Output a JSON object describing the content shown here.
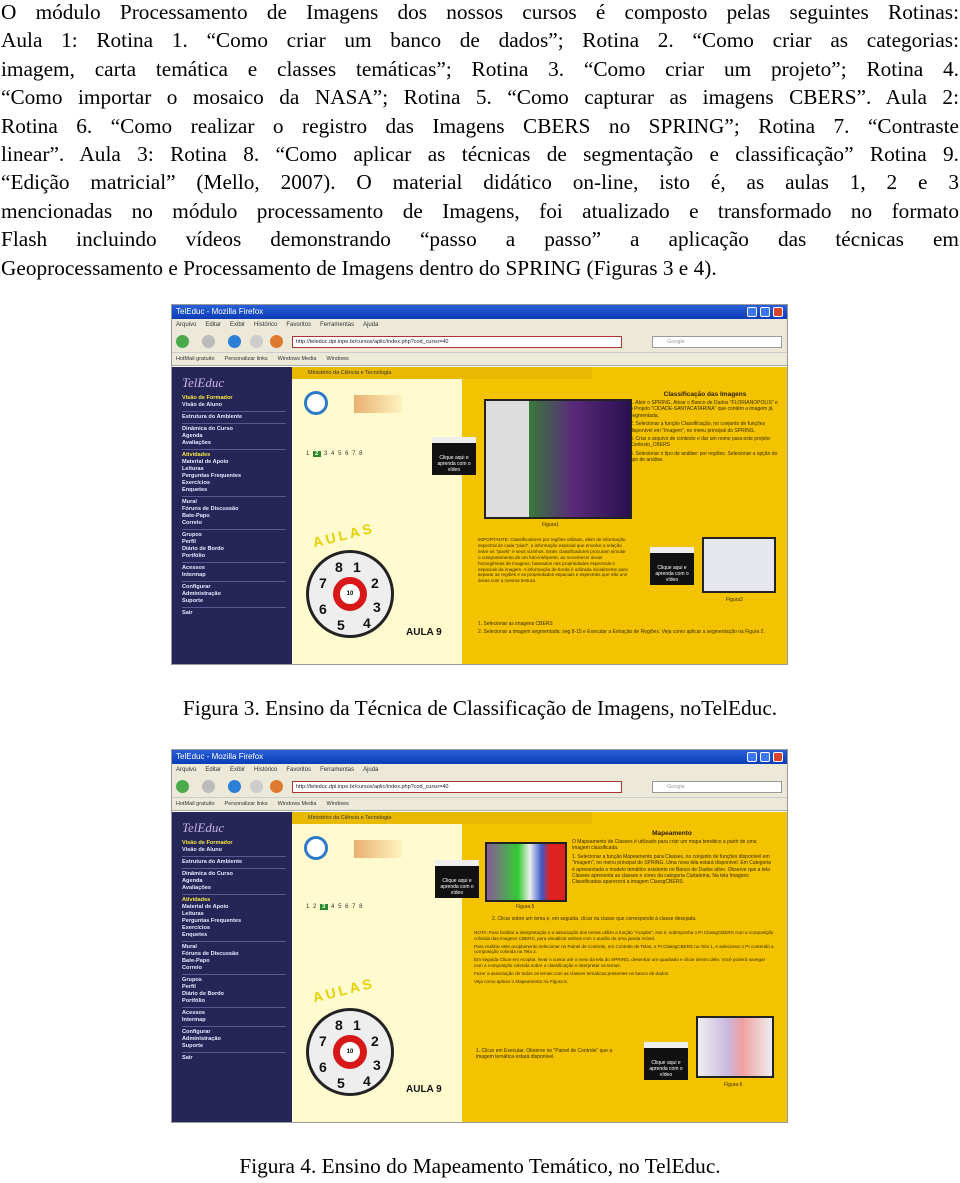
{
  "paragraph_lines": [
    "O módulo Processamento de Imagens dos nossos cursos é composto pelas seguintes Rotinas:",
    "Aula 1: Rotina 1. “Como criar um banco de dados”; Rotina 2. “Como criar as categorias:",
    "imagem, carta temática e classes temáticas”; Rotina 3. “Como criar um projeto”; Rotina 4.",
    "“Como importar o mosaico da NASA”; Rotina 5. “Como capturar as imagens CBERS”. Aula 2:",
    "Rotina 6. “Como realizar o registro das Imagens CBERS no SPRING”; Rotina 7. “Contraste",
    "linear”. Aula 3: Rotina 8. “Como aplicar as técnicas de segmentação e classificação” Rotina 9.",
    "“Edição matricial” (Mello, 2007). O material didático on-line, isto é, as aulas 1, 2 e 3",
    "mencionadas no módulo processamento de Imagens, foi atualizado e transformado no formato",
    "Flash incluindo vídeos demonstrando “passo a passo” a aplicação das técnicas em",
    "Geoprocessamento e Processamento de Imagens dentro do SPRING (Figuras 3 e 4)."
  ],
  "browser": {
    "window_title": "TelEduc - Mozilla Firefox",
    "menu": [
      "Arquivo",
      "Editar",
      "Exibir",
      "Histórico",
      "Favoritos",
      "Ferramentas",
      "Ajuda"
    ],
    "url": "http://teleduc.dpi.inpe.br/cursos/aplic/index.php?cod_curso=40",
    "search_placeholder": "Google",
    "bookmarks": [
      "HotMail gratuito",
      "Personalizar links",
      "Windows Media",
      "Windows"
    ],
    "header_text": "Ministério da Ciência e Tecnologia",
    "logo_text": "TelEduc",
    "sidebar_groups": [
      [
        {
          "label": "Visão de Formador",
          "highlight": true
        },
        {
          "label": "Visão de Aluno"
        }
      ],
      [
        {
          "label": "Estrutura do Ambiente"
        }
      ],
      [
        {
          "label": "Dinâmica do Curso"
        },
        {
          "label": "Agenda"
        },
        {
          "label": "Avaliações"
        }
      ],
      [
        {
          "label": "Atividades",
          "highlight": true
        },
        {
          "label": "Material de Apoio"
        },
        {
          "label": "Leituras"
        },
        {
          "label": "Perguntas Frequentes"
        },
        {
          "label": "Exercícios"
        },
        {
          "label": "Enquetes"
        }
      ],
      [
        {
          "label": "Mural"
        },
        {
          "label": "Fóruns de Discussão"
        },
        {
          "label": "Bate-Papo"
        },
        {
          "label": "Correio"
        }
      ],
      [
        {
          "label": "Grupos"
        },
        {
          "label": "Perfil"
        },
        {
          "label": "Diário de Bordo"
        },
        {
          "label": "Portfólio"
        }
      ],
      [
        {
          "label": "Acessos"
        },
        {
          "label": "Intermap"
        }
      ],
      [
        {
          "label": "Configurar"
        },
        {
          "label": "Administração"
        },
        {
          "label": "Suporte"
        }
      ],
      [
        {
          "label": "Sair"
        }
      ]
    ],
    "video_button": "Clique aqui e aprenda com o vídeo",
    "aulas_label": "AULAS",
    "aula_current": "AULA 9",
    "wheel_center": "10",
    "wheel_numbers": [
      "1",
      "2",
      "3",
      "4",
      "5",
      "6",
      "7",
      "8"
    ],
    "pager": [
      "1",
      "2",
      "3",
      "4",
      "5",
      "6",
      "7",
      "8"
    ]
  },
  "figure3": {
    "caption": "Figura 3. Ensino da Técnica de Classificação de Imagens, noTelEduc.",
    "panel_title": "Classificação das Imagens",
    "steps": [
      "1. Abrir o SPRING, Ativar o Banco de Dados \"FLORIANOPOLIS\" e o Projeto \"CIDADE-SANTACATARINA\" que contém a imagem já segmentada.",
      "2. Selecionar a função Classificação, no conjunto de funções disponível em \"Imagem\", no menu principal do SPRING.",
      "3. Criar o arquivo de contexto e dar um nome para este projeto: Contexto_CBERS",
      "4. Selecionar o tipo de análise: por regiões. Selecionar a opção do tipo de análise."
    ],
    "important": "IMPORTANTE: Classificadores por regiões utilizam, além de informação espectral de cada \"pixel\", a informação espacial que envolve a relação entre os \"pixels\" e seus vizinhos. Estes classificadores procuram simular o comportamento de um foto-intérprete, ao reconhecer áreas homogêneas de imagens, baseados nas propriedades espectrais e espaciais da imagem. A informação de borda é utilizada inicialmente para separar as regiões e as propriedades espaciais e espectrais que irão unir áreas com a mesma textura.",
    "tasks": [
      "1. Selecionar as imagens CBERS",
      "2. Selecionar a imagem segmentada: seg 8-15 e Executar a Extração de Regiões. Veja como aplicar a segmentação na Figura 2."
    ],
    "fig_labels": [
      "Figura1",
      "Figura2"
    ]
  },
  "figure4": {
    "caption": "Figura 4. Ensino do Mapeamento Temático, no TelEduc.",
    "panel_title": "Mapeamento",
    "intro": "O Mapeamento de Classes é utilizado para criar um mapa temático a partir de uma imagem classificada.",
    "steps": [
      "1. Selecionar a função Mapeamento para Classes, no conjunto de funções disponível em \"Imagem\", no menu principal do SPRING. Uma nova tela estará disponível. Em Categoria é apresentada o modelo temático existente no Banco de Dados ativo. Observe que a tela Classes apresenta as classes e cores da categoria Cartatema. Na tela Imagens Classificadas aparecerá a imagem ClassgCBERS.",
      "2. Clicar sobre um tema e, em seguida, clicar na classe que corresponde à classe desejada."
    ],
    "notes": [
      "NOTA: Para facilitar a interpretação e a associação dos temas utilize a função \"Acoplar\", isto é, sobreponha o PI ClassgCBERS com a composição colorida das imagens CBERS, para visualizar ambos com o auxílio de uma janela móvel.",
      "Para realizar este acoplamento selecionar no Painel de Controle, em Controle de Telas, o PI ClassgCBERS na Tela 1, e selecionar o PI contendo a composição colorida na Tela 2.",
      "Em seguida Clicar em Acoplar, levar o cursor até o meio da tela do SPRING, desenhar um quadrado e clicar dentro dele. Você poderá navegar com a composição colorida sobre a classificação e interpretar os temas.",
      "Fazer a associação de todos os temas com as classes temáticas presentes no banco de dados.",
      "Veja como aplicar o Mapeamento na Figura 6."
    ],
    "task": "1. Clicar em Executar. Observe no \"Painel de Controle\" que a imagem temática estará disponível.",
    "fig_labels": [
      "Figura 5",
      "Figura 6"
    ]
  }
}
